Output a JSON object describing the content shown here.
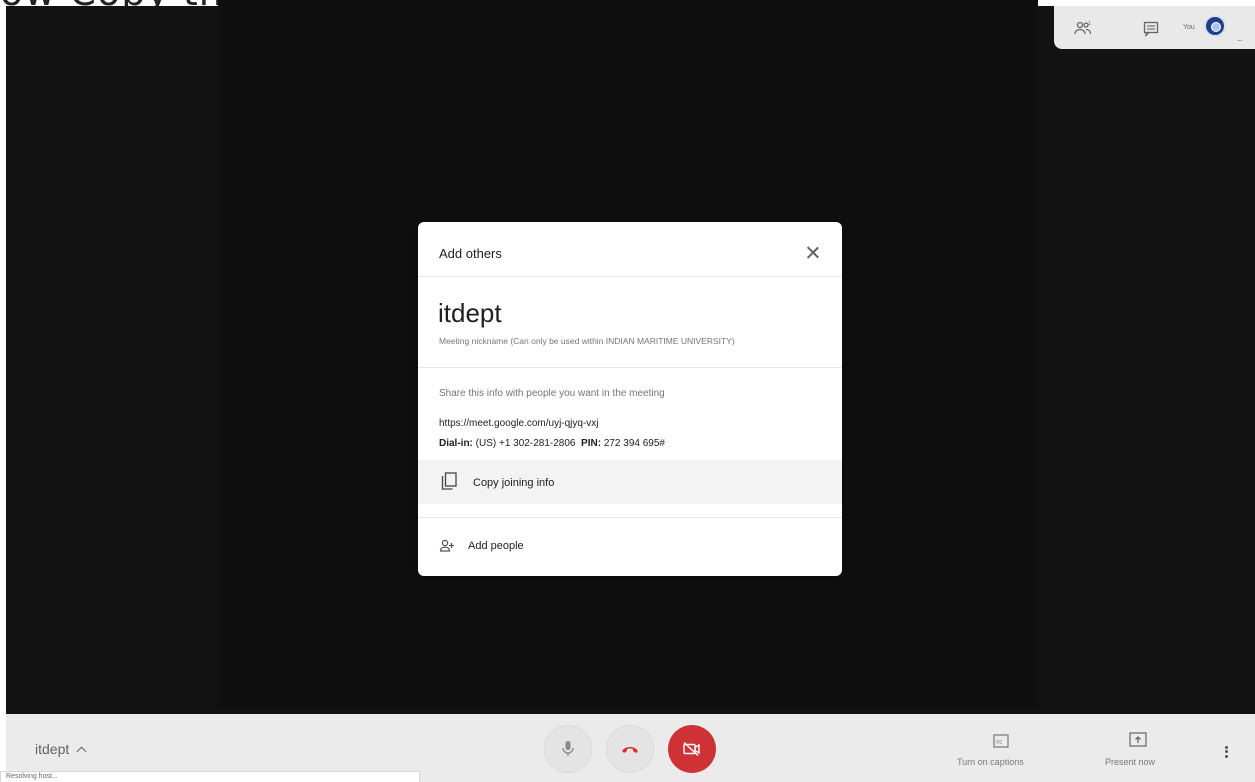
{
  "header": {
    "caption": "ow Copy the info display on the screen"
  },
  "top_panel": {
    "people_icon": "people-icon",
    "chat_icon": "chat-icon",
    "you_label": "You",
    "more_label": "..."
  },
  "dialog": {
    "title": "Add others",
    "nickname": "itdept",
    "nickname_note": "Meeting nickname (Can only be used within INDIAN MARITIME UNIVERSITY)",
    "share_text": "Share this info with people you want in the meeting",
    "meet_url": "https://meet.google.com/uyj-qjyq-vxj",
    "dialin_label": "Dial-in:",
    "dialin_number": "(US) +1 302-281-2806",
    "pin_label": "PIN:",
    "pin_value": "272 394 695#",
    "copy_label": "Copy joining info",
    "add_people_label": "Add people"
  },
  "bottom_bar": {
    "meeting_name": "itdept",
    "status": "Resolving host...",
    "captions_label": "Turn on captions",
    "present_label": "Present now"
  },
  "colors": {
    "stage": "#121212",
    "end_call_red": "#cf3236",
    "bar": "#ebebeb"
  }
}
